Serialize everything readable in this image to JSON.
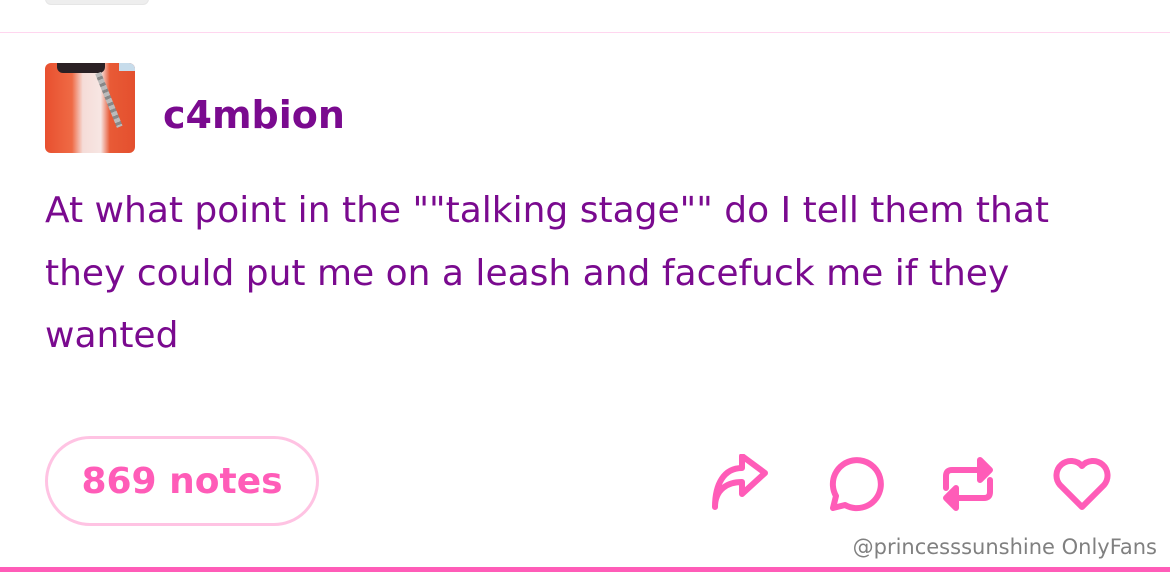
{
  "post": {
    "username": "c4mbion",
    "body": "At what point in the \"\"talking stage\"\" do I tell them that they could put me on a leash and facefuck me if they wanted",
    "notes_label": "869 notes"
  },
  "actions": [
    {
      "icon": "share-icon",
      "label": "share"
    },
    {
      "icon": "comment-icon",
      "label": "reply"
    },
    {
      "icon": "reblog-icon",
      "label": "reblog"
    },
    {
      "icon": "heart-icon",
      "label": "like"
    }
  ],
  "watermark": "@princesssunshine OnlyFans",
  "colors": {
    "text": "#7a0a8f",
    "accent": "#ff5cb8",
    "border": "#ffc3e3"
  }
}
